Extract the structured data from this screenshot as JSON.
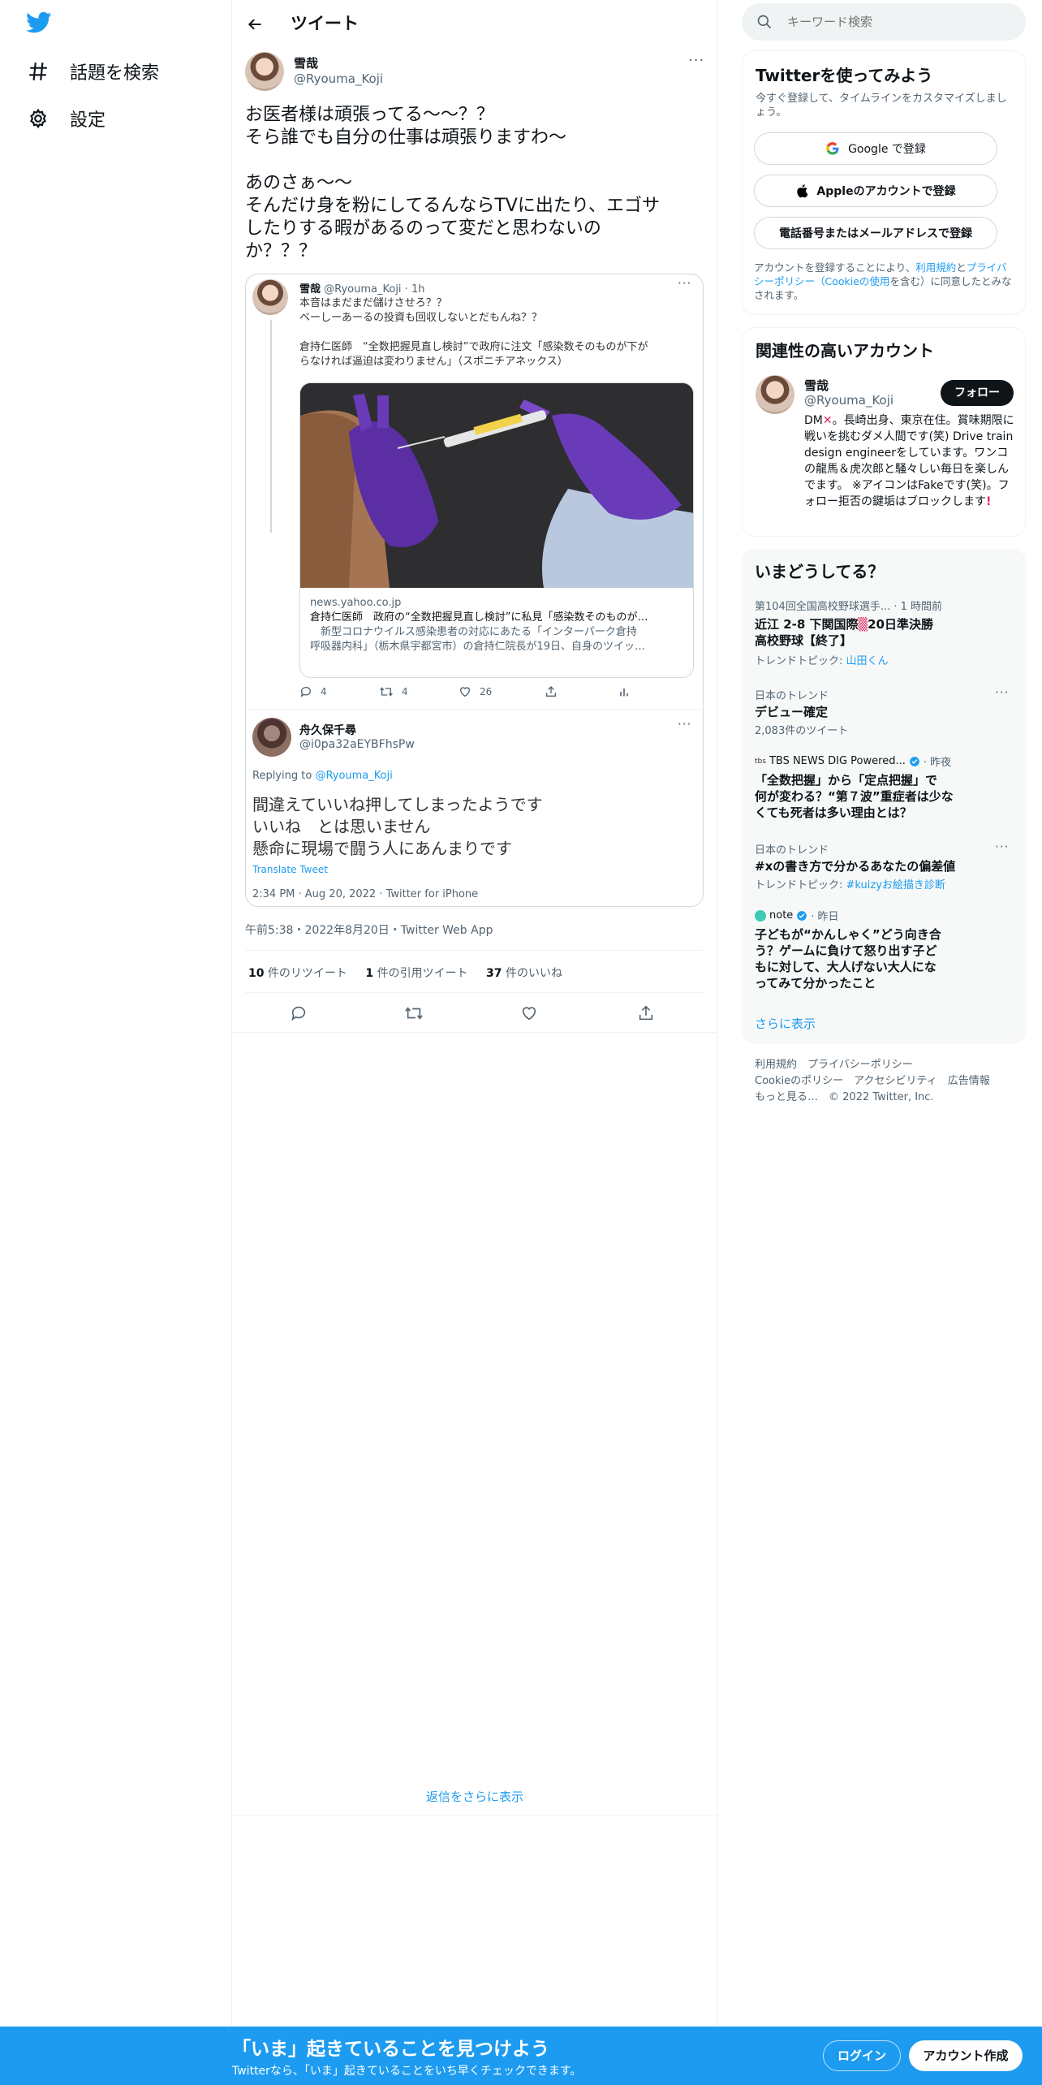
{
  "nav": {
    "explore_label": "話題を検索",
    "settings_label": "設定"
  },
  "header": {
    "title": "ツイート"
  },
  "tweet": {
    "author_name": "雪哉",
    "author_handle": "@Ryouma_Koji",
    "text_lines": [
      "お医者様は頑張ってる～～？？",
      "そら誰でも自分の仕事は頑張りますわ～",
      "",
      "あのさぁ～～",
      "そんだけ身を粉にしてるんならTVに出たり、エゴサ",
      "したりする暇があるのって変だと思わないの",
      "か？？？"
    ],
    "timestamp": "午前5:38・2022年8月20日・Twitter Web App",
    "stats": {
      "retweets_count": "10",
      "retweets_label": "件のリツイート",
      "quotes_count": "1",
      "quotes_label": "件の引用ツイート",
      "likes_count": "37",
      "likes_label": "件のいいね"
    }
  },
  "quoted": {
    "author_name": "雪哉",
    "author_handle_time": "@Ryouma_Koji · 1h",
    "line1": "本音はまだまだ儲けさせろ？？",
    "line2": "ベーしーあーるの投資も回収しないとだもんね？？",
    "line3": "倉持仁医師　“全数把握見直し検討”で政府に注文「感染数そのものが下が",
    "line4": "らなければ逼迫は変わりません」（スポニチアネックス）",
    "link_domain": "news.yahoo.co.jp",
    "link_title": "倉持仁医師　政府の“全数把握見直し検討”に私見「感染数そのものが…",
    "link_desc1": "　新型コロナウイルス感染患者の対応にあたる「インターパーク倉持",
    "link_desc2": "呼吸器内科」（栃木県宇都宮市）の倉持仁院長が19日、自身のツイッ…",
    "replies": "4",
    "retweets": "4",
    "likes": "26"
  },
  "reply": {
    "author_name": "舟久保千尋",
    "author_handle": "@i0pa32aEYBFhsPw",
    "replying_prefix": "Replying to ",
    "replying_to": "@Ryouma_Koji",
    "line1": "間違えていいね押してしまったようです",
    "line2": "いいね　とは思いません",
    "line3": "懸命に現場で闘う人にあんまりです",
    "translate": "Translate Tweet",
    "timestamp": "2:34 PM · Aug 20, 2022 · Twitter for iPhone"
  },
  "more_replies": "返信をさらに表示",
  "search": {
    "placeholder": "キーワード検索"
  },
  "signup": {
    "title": "Twitterを使ってみよう",
    "subtitle": "今すぐ登録して、タイムラインをカスタマイズしましょう。",
    "google_label": "Google で登録",
    "apple_label": "Appleのアカウントで登録",
    "phone_label": "電話番号またはメールアドレスで登録",
    "legal_1": "アカウントを登録することにより、",
    "legal_terms": "利用規約",
    "legal_and": "と",
    "legal_privacy": "プライバシーポリシー（Cookieの使用",
    "legal_2": "を含む）に同意したとみなされます。"
  },
  "related": {
    "title": "関連性の高いアカウント",
    "name": "雪哉",
    "handle": "@Ryouma_Koji",
    "follow_label": "フォロー",
    "bio_a": "DM",
    "bio_b": "。長崎出身、東京在住。賞味期限に戦いを挑むダメ人間です(笑) Drive train design engineerをしています。ワンコの龍馬＆虎次郎と騒々しい毎日を楽しんでます。 ※アイコンはFakeです(笑)。フォロー拒否の鍵垢はブロックします"
  },
  "trends": {
    "title": "いまどうしてる？",
    "items": [
      {
        "meta": "第104回全国高校野球選手... · 1 時間前",
        "title1": "近江 2-8 下関国際",
        "title1b": "20日準決勝",
        "title2": "高校野球【終了】",
        "sub_prefix": "トレンドトピック: ",
        "sub_link": "山田くん"
      },
      {
        "meta": "日本のトレンド",
        "title": "デビュー確定",
        "sub": "2,083件のツイート"
      },
      {
        "meta_source": "TBS NEWS DIG Powered...",
        "meta_time": " · 昨夜",
        "title1": "「全数把握」から「定点把握」で",
        "title2": "何が変わる？“第７波”重症者は少な",
        "title3": "くても死者は多い理由とは？"
      },
      {
        "meta": "日本のトレンド",
        "title": "#xの書き方で分かるあなたの偏差値",
        "sub_prefix": "トレンドトピック: ",
        "sub_link": "#kuizyお絵描き診断"
      },
      {
        "meta_source": "note",
        "meta_time": " · 昨日",
        "title1": "子どもが“かんしゃく”どう向き合",
        "title2": "う？ゲームに負けて怒り出す子ど",
        "title3": "もに対して、大人げない大人にな",
        "title4": "ってみて分かったこと"
      }
    ],
    "show_more": "さらに表示"
  },
  "footer": {
    "terms": "利用規約",
    "privacy": "プライバシーポリシー",
    "cookie": "Cookieのポリシー",
    "accessibility": "アクセシビリティ",
    "ads": "広告情報",
    "more": "もっと見る…",
    "copyright": "© 2022 Twitter, Inc."
  },
  "bottom_bar": {
    "headline": "「いま」起きていることを見つけよう",
    "sub": "Twitterなら、「いま」起きていることをいち早くチェックできます。",
    "login": "ログイン",
    "signup": "アカウント作成"
  },
  "colors": {
    "brand": "#1d9bf0",
    "text": "#0f1419",
    "muted": "#536471"
  }
}
